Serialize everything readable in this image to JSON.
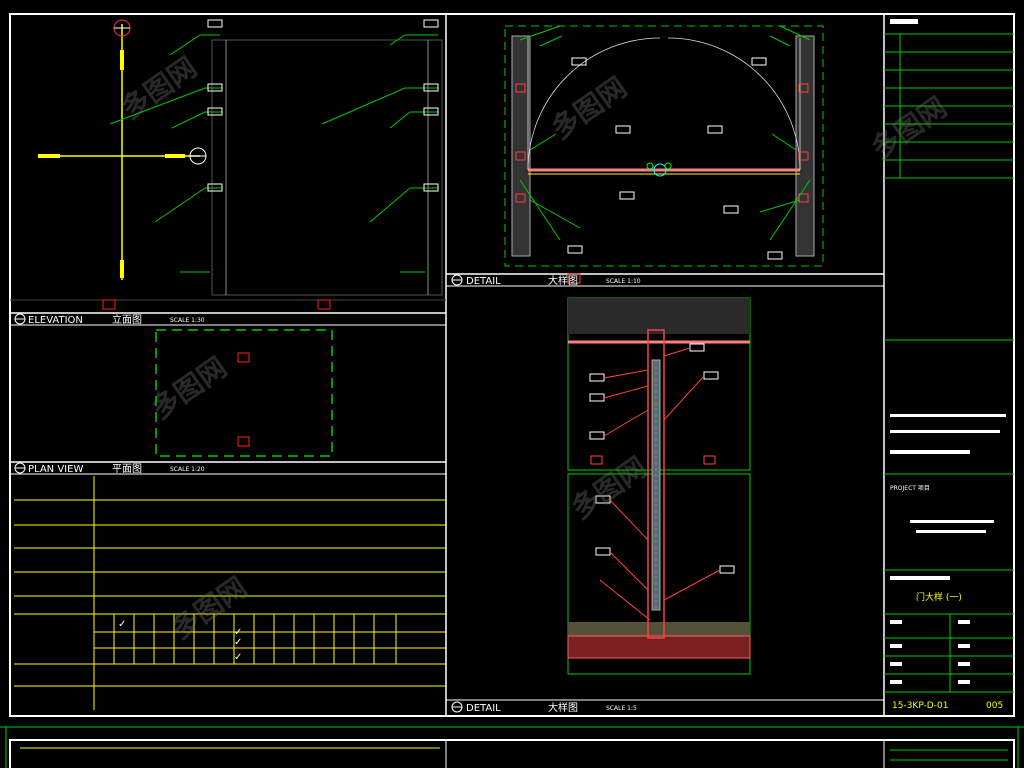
{
  "panels": {
    "elevation": {
      "title": "ELEVATION",
      "cn": "立面图",
      "scale": "SCALE 1:30"
    },
    "plan": {
      "title": "PLAN VIEW",
      "cn": "平面图",
      "scale": "SCALE 1:20"
    },
    "detail_top": {
      "title": "DETAIL",
      "cn": "大样图",
      "scale": "SCALE 1:10"
    },
    "detail_bottom": {
      "title": "DETAIL",
      "cn": "大样图",
      "scale": "SCALE 1:5"
    }
  },
  "title_block": {
    "project_label": "PROJECT 项目",
    "drawing_title": "门大样 (一)",
    "drawing_no": "15-3KP-D-01",
    "sheet_no": "005"
  },
  "checkmarks": [
    "✓",
    "✓",
    "✓",
    "✓"
  ],
  "watermark": "多图网"
}
